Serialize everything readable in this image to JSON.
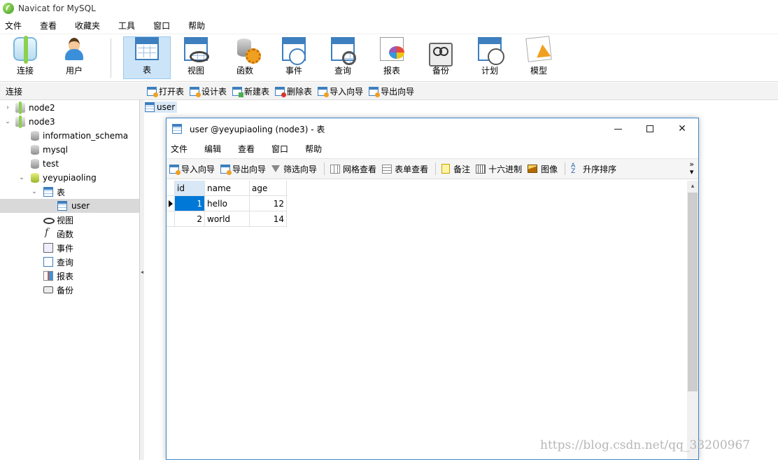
{
  "app": {
    "title": "Navicat for MySQL"
  },
  "menu": [
    "文件",
    "查看",
    "收藏夹",
    "工具",
    "窗口",
    "帮助"
  ],
  "toolbar": [
    {
      "label": "连接",
      "icon": "connection-icon",
      "active": false
    },
    {
      "label": "用户",
      "icon": "user-icon",
      "active": false
    },
    {
      "label": "表",
      "icon": "table-icon",
      "active": true
    },
    {
      "label": "视图",
      "icon": "view-icon",
      "active": false
    },
    {
      "label": "函数",
      "icon": "function-icon",
      "active": false
    },
    {
      "label": "事件",
      "icon": "event-icon",
      "active": false
    },
    {
      "label": "查询",
      "icon": "query-icon",
      "active": false
    },
    {
      "label": "报表",
      "icon": "report-icon",
      "active": false
    },
    {
      "label": "备份",
      "icon": "backup-icon",
      "active": false
    },
    {
      "label": "计划",
      "icon": "schedule-icon",
      "active": false
    },
    {
      "label": "模型",
      "icon": "model-icon",
      "active": false
    }
  ],
  "connection_panel": {
    "header": "连接"
  },
  "object_toolbar": [
    "打开表",
    "设计表",
    "新建表",
    "删除表",
    "导入向导",
    "导出向导"
  ],
  "tree": [
    {
      "label": "node2",
      "caret": "›",
      "icon": "connection-icon"
    },
    {
      "label": "node3",
      "caret": "⌄",
      "icon": "connection-icon"
    },
    {
      "label": "information_schema",
      "icon": "database-icon"
    },
    {
      "label": "mysql",
      "icon": "database-icon"
    },
    {
      "label": "test",
      "icon": "database-icon"
    },
    {
      "label": "yeyupiaoling",
      "caret": "⌄",
      "icon": "database-open-icon"
    },
    {
      "label": "表",
      "caret": "⌄",
      "icon": "table-icon"
    },
    {
      "label": "user",
      "icon": "table-icon",
      "selected": true
    },
    {
      "label": "视图",
      "icon": "view-icon"
    },
    {
      "label": "函数",
      "icon": "function-icon"
    },
    {
      "label": "事件",
      "icon": "event-icon"
    },
    {
      "label": "查询",
      "icon": "query-icon"
    },
    {
      "label": "报表",
      "icon": "report-icon"
    },
    {
      "label": "备份",
      "icon": "backup-icon"
    }
  ],
  "object_tab": {
    "label": "user"
  },
  "child_window": {
    "title": "user @yeyupiaoling (node3) - 表",
    "menu": [
      "文件",
      "编辑",
      "查看",
      "窗口",
      "帮助"
    ],
    "toolbar": {
      "import": "导入向导",
      "export": "导出向导",
      "filter": "筛选向导",
      "grid_view": "网格查看",
      "form_view": "表单查看",
      "note": "备注",
      "hex": "十六进制",
      "image": "图像",
      "sort": "升序排序",
      "sort_icon_text": "A Z",
      "overflow": "»"
    },
    "grid": {
      "columns": [
        "id",
        "name",
        "age"
      ],
      "rows": [
        [
          "1",
          "hello",
          "12"
        ],
        [
          "2",
          "world",
          "14"
        ]
      ]
    }
  },
  "watermark": "https://blog.csdn.net/qq_33200967"
}
